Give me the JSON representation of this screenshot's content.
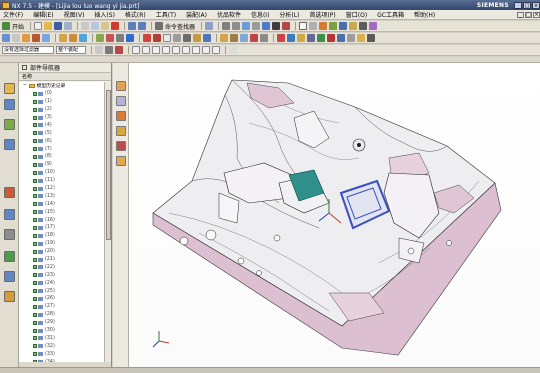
{
  "window": {
    "app_title": "NX 7.5 - 建模 - [Lijia lou luo wang yi jia.prt]",
    "brand": "SIEMENS"
  },
  "menu": [
    "文件(F)",
    "编辑(E)",
    "视图(V)",
    "插入(S)",
    "格式(R)",
    "工具(T)",
    "装配(A)",
    "优品软件",
    "信息(I)",
    "分析(L)",
    "首选项(P)",
    "窗口(O)",
    "GC工具箱",
    "帮助(H)"
  ],
  "toolbar": {
    "start_label": "开始",
    "command_finder_label": "命令查找器",
    "filter_label": "没有选择过滤器",
    "assembly_scope_label": "整个装配"
  },
  "navigator": {
    "title": "部件导航器",
    "col_name": "名称",
    "root_item": "模型历史记录",
    "feature_rows": [
      "(0)",
      "(1)",
      "(2)",
      "(3)",
      "(4)",
      "(5)",
      "(6)",
      "(7)",
      "(8)",
      "(9)",
      "(10)",
      "(11)",
      "(12)",
      "(13)",
      "(14)",
      "(15)",
      "(16)",
      "(17)",
      "(18)",
      "(19)",
      "(20)",
      "(21)",
      "(22)",
      "(23)",
      "(24)",
      "(25)",
      "(26)",
      "(27)",
      "(28)",
      "(29)",
      "(30)",
      "(31)",
      "(32)",
      "(33)",
      "(34)"
    ]
  },
  "colors": {
    "model_fill": "#eeedef",
    "model_side": "#dcbfd0",
    "edge": "#2a2a2a",
    "teal_feature": "#2f8f8a",
    "selection_blue": "#3a4fc0"
  }
}
